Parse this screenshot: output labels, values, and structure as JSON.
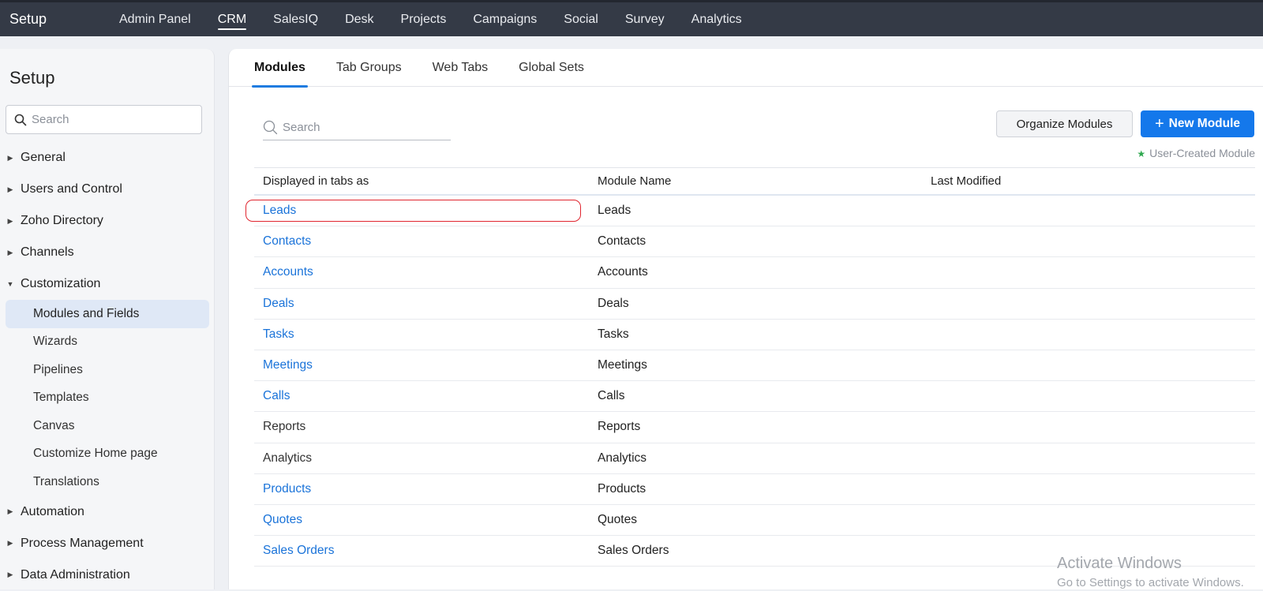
{
  "topbar": {
    "brand": "Setup",
    "nav": [
      "Admin Panel",
      "CRM",
      "SalesIQ",
      "Desk",
      "Projects",
      "Campaigns",
      "Social",
      "Survey",
      "Analytics"
    ],
    "active": "CRM"
  },
  "sidebar": {
    "title": "Setup",
    "search_placeholder": "Search",
    "sections": [
      {
        "label": "General",
        "expanded": false
      },
      {
        "label": "Users and Control",
        "expanded": false
      },
      {
        "label": "Zoho Directory",
        "expanded": false
      },
      {
        "label": "Channels",
        "expanded": false
      },
      {
        "label": "Customization",
        "expanded": true,
        "children": [
          "Modules and Fields",
          "Wizards",
          "Pipelines",
          "Templates",
          "Canvas",
          "Customize Home page",
          "Translations"
        ],
        "active_child": "Modules and Fields"
      },
      {
        "label": "Automation",
        "expanded": false
      },
      {
        "label": "Process Management",
        "expanded": false
      },
      {
        "label": "Data Administration",
        "expanded": false
      }
    ]
  },
  "main": {
    "tabs": [
      "Modules",
      "Tab Groups",
      "Web Tabs",
      "Global Sets"
    ],
    "active_tab": "Modules",
    "search_placeholder": "Search",
    "organize_button": "Organize Modules",
    "new_button": "New Module",
    "legend": "User-Created Module",
    "columns": [
      "Displayed in tabs as",
      "Module Name",
      "Last Modified"
    ],
    "rows": [
      {
        "tab": "Leads",
        "module": "Leads",
        "modified": "",
        "link": true,
        "highlighted": true
      },
      {
        "tab": "Contacts",
        "module": "Contacts",
        "modified": "",
        "link": true
      },
      {
        "tab": "Accounts",
        "module": "Accounts",
        "modified": "",
        "link": true
      },
      {
        "tab": "Deals",
        "module": "Deals",
        "modified": "",
        "link": true
      },
      {
        "tab": "Tasks",
        "module": "Tasks",
        "modified": "",
        "link": true
      },
      {
        "tab": "Meetings",
        "module": "Meetings",
        "modified": "",
        "link": true
      },
      {
        "tab": "Calls",
        "module": "Calls",
        "modified": "",
        "link": true
      },
      {
        "tab": "Reports",
        "module": "Reports",
        "modified": "",
        "link": false
      },
      {
        "tab": "Analytics",
        "module": "Analytics",
        "modified": "",
        "link": false
      },
      {
        "tab": "Products",
        "module": "Products",
        "modified": "",
        "link": true
      },
      {
        "tab": "Quotes",
        "module": "Quotes",
        "modified": "",
        "link": true
      },
      {
        "tab": "Sales Orders",
        "module": "Sales Orders",
        "modified": "",
        "link": true
      }
    ]
  },
  "watermark": {
    "line1": "Activate Windows",
    "line2": "Go to Settings to activate Windows."
  },
  "colors": {
    "topbar": "#343a46",
    "accent": "#1478eb",
    "link": "#1a73d9",
    "highlight": "#e0252f",
    "user_created_star": "#2fa84f"
  }
}
